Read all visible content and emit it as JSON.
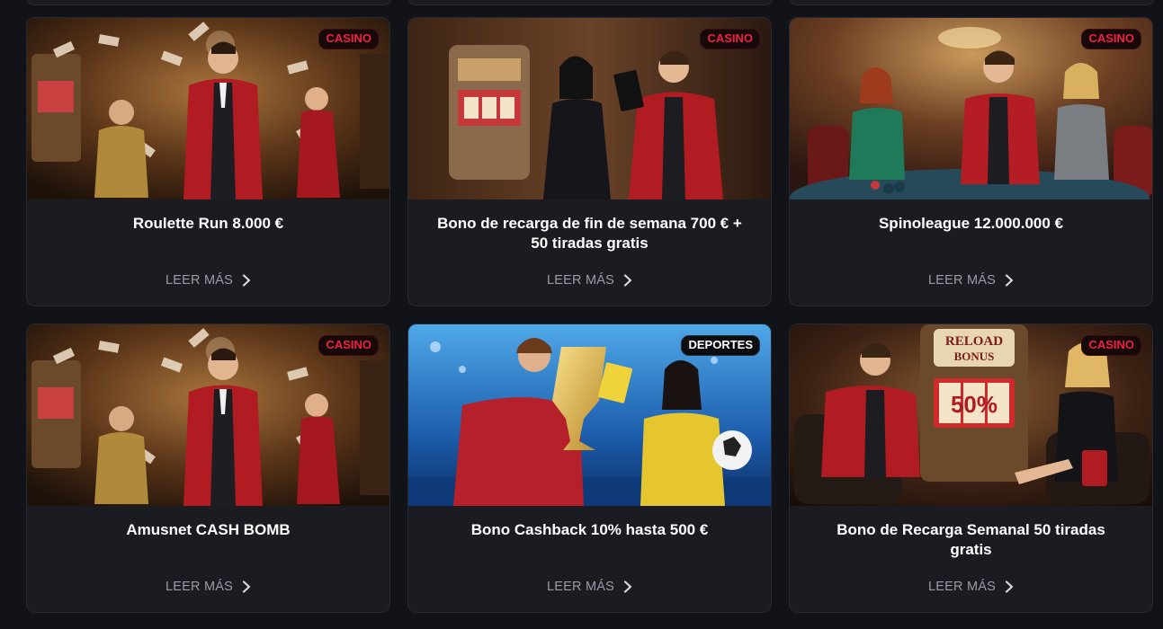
{
  "colors": {
    "page_bg": "#111318",
    "card_bg": "#1a1c22",
    "badge_casino_text": "#f0223f",
    "badge_sports_text": "#ffffff",
    "link_text": "#9a9da6"
  },
  "promotions": [
    {
      "category": "CASINO",
      "title": "Roulette Run 8.000 €",
      "link": "LEER MÁS",
      "image": "casino-man-money-rain"
    },
    {
      "category": "CASINO",
      "title": "Bono de recarga de fin de semana 700 € + 50 tiradas gratis",
      "link": "LEER MÁS",
      "image": "casino-couple-slot-machine"
    },
    {
      "category": "CASINO",
      "title": "Spinoleague 12.000.000 €",
      "link": "LEER MÁS",
      "image": "casino-poker-table"
    },
    {
      "category": "CASINO",
      "title": "Amusnet CASH BOMB",
      "link": "LEER MÁS",
      "image": "casino-man-money-rain"
    },
    {
      "category": "DEPORTES",
      "title": "Bono Cashback 10% hasta 500 €",
      "link": "LEER MÁS",
      "image": "sports-trophy-stadium"
    },
    {
      "category": "CASINO",
      "title": "Bono de Recarga Semanal 50 tiradas gratis",
      "link": "LEER MÁS",
      "image": "casino-reload-bonus-slot",
      "image_text": [
        "RELOAD",
        "BONUS",
        "50%"
      ]
    }
  ]
}
